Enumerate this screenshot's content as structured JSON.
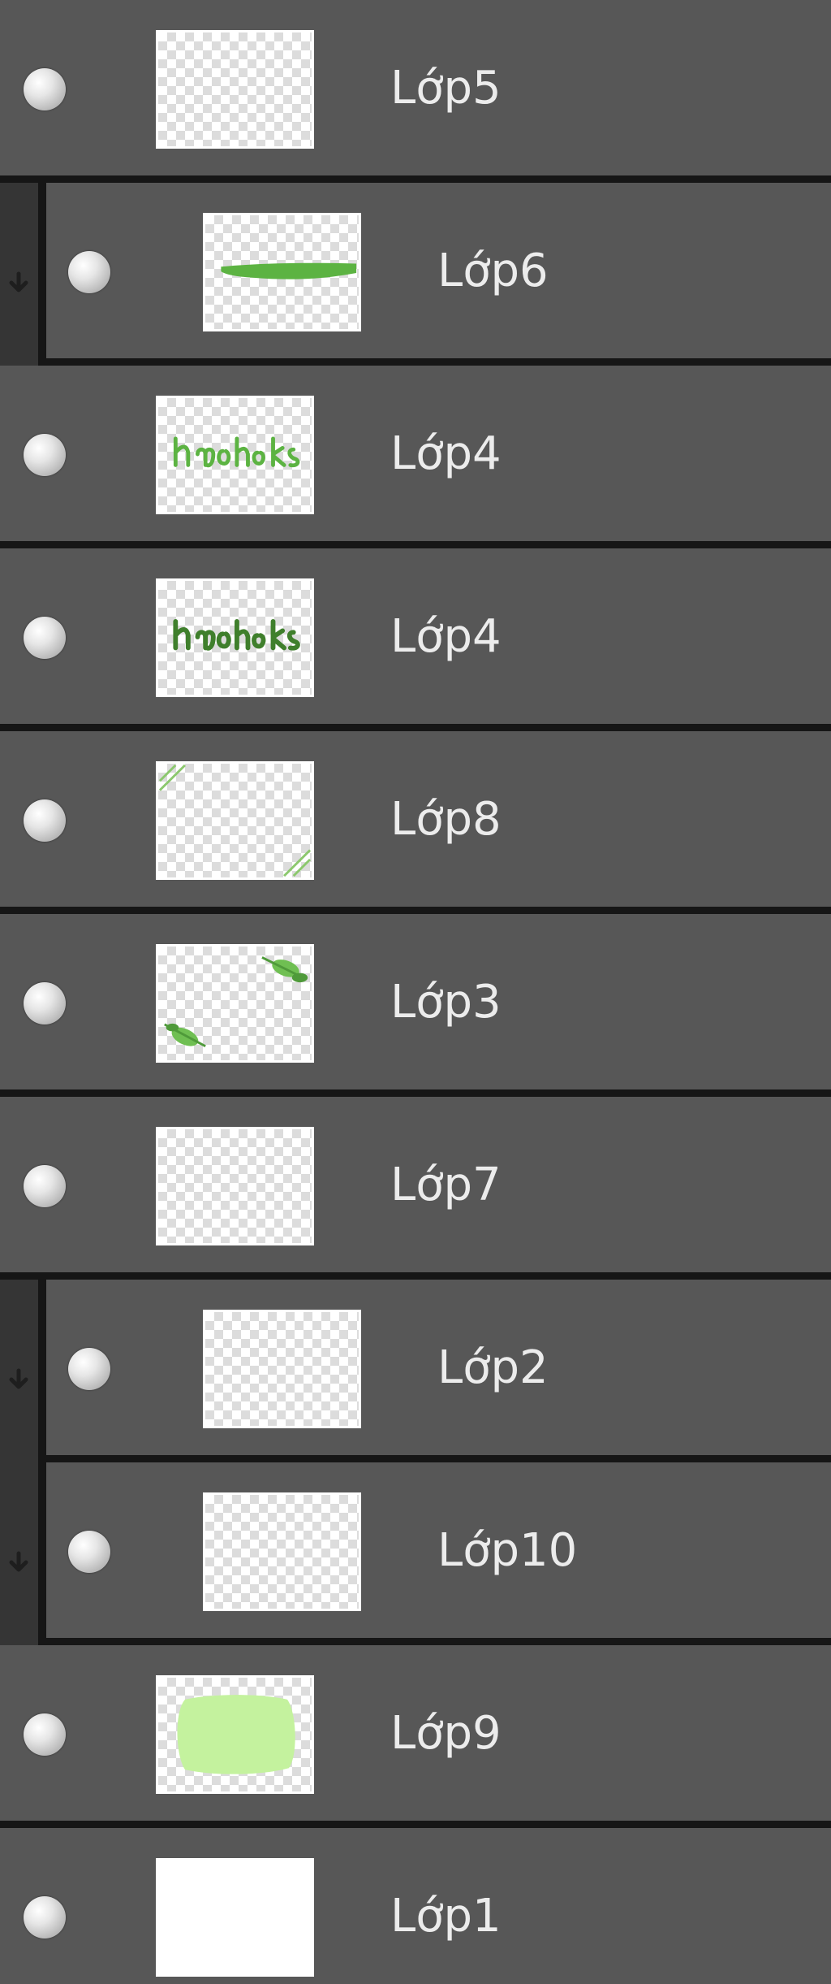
{
  "layers_panel": {
    "layers": [
      {
        "name": "Lớp5",
        "clipped": false,
        "thumbnail": "transparent",
        "visibility_icon": "visibility-dot-icon"
      },
      {
        "name": "Lớp6",
        "clipped": true,
        "thumbnail": "green-brush-stroke",
        "visibility_icon": "visibility-dot-icon"
      },
      {
        "name": "Lớp4",
        "clipped": false,
        "thumbnail": "green-script-text",
        "visibility_icon": "visibility-dot-icon"
      },
      {
        "name": "Lớp4",
        "clipped": false,
        "thumbnail": "green-script-text",
        "visibility_icon": "visibility-dot-icon"
      },
      {
        "name": "Lớp8",
        "clipped": false,
        "thumbnail": "corner-lines",
        "visibility_icon": "visibility-dot-icon"
      },
      {
        "name": "Lớp3",
        "clipped": false,
        "thumbnail": "corner-leaves",
        "visibility_icon": "visibility-dot-icon"
      },
      {
        "name": "Lớp7",
        "clipped": false,
        "thumbnail": "transparent",
        "visibility_icon": "visibility-dot-icon"
      },
      {
        "name": "Lớp2",
        "clipped": true,
        "thumbnail": "transparent",
        "visibility_icon": "visibility-dot-icon"
      },
      {
        "name": "Lớp10",
        "clipped": true,
        "thumbnail": "transparent",
        "visibility_icon": "visibility-dot-icon"
      },
      {
        "name": "Lớp9",
        "clipped": false,
        "thumbnail": "light-green-blob",
        "visibility_icon": "visibility-dot-icon"
      },
      {
        "name": "Lớp1",
        "clipped": false,
        "thumbnail": "solid-white",
        "visibility_icon": "visibility-dot-icon"
      }
    ],
    "colors": {
      "row_background": "#575757",
      "separator": "#161616",
      "clip_strip": "#353535",
      "text": "#ececec",
      "thumbnail_green": "#5cb342",
      "thumbnail_light_green": "#c4f29e"
    }
  }
}
